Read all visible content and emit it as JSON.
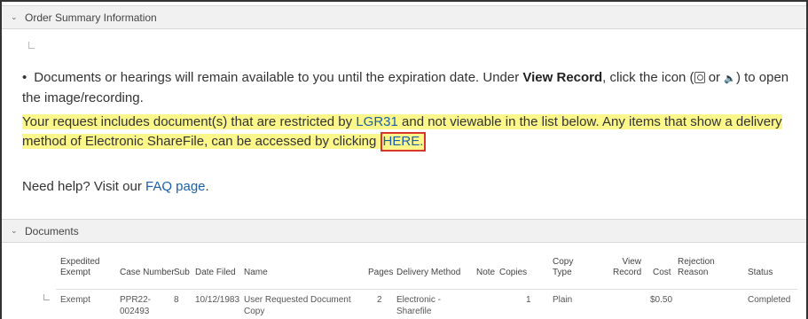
{
  "order_section": {
    "title": "Order Summary Information"
  },
  "notice": {
    "bullet": "•",
    "text_before": "Documents or hearings will remain available to you until the expiration date. Under ",
    "view_record": "View Record",
    "text_middle": ", click the icon (",
    "icon_or": " or ",
    "text_after": ") to open the image/recording."
  },
  "restricted": {
    "text_before": "Your request includes document(s) that are restricted by ",
    "lgr_link": "LGR31",
    "text_middle": " and not viewable in the list below. Any items that show a delivery method of Electronic ShareFile, can be accessed by clicking ",
    "here_link": "HERE."
  },
  "help": {
    "text": "Need help? Visit our ",
    "faq_link": "FAQ page",
    "end": "."
  },
  "documents_section": {
    "title": "Documents"
  },
  "table": {
    "headers": {
      "expedited": "Expedited",
      "exempt": "Exempt",
      "case_number": "Case Number",
      "sub": "Sub",
      "date_filed": "Date Filed",
      "name": "Name",
      "pages": "Pages",
      "delivery_method": "Delivery Method",
      "note": "Note",
      "copies": "Copies",
      "copy": "Copy",
      "type": "Type",
      "view": "View",
      "record": "Record",
      "cost": "Cost",
      "rejection": "Rejection",
      "reason": "Reason",
      "status": "Status"
    },
    "rows": [
      {
        "expedited": "Exempt",
        "case_number_1": "PPR22-",
        "case_number_2": "002493",
        "sub": "8",
        "date_filed": "10/12/1983",
        "name_1": "User Requested Document",
        "name_2": "Copy",
        "pages": "2",
        "delivery_1": "Electronic -",
        "delivery_2": "Sharefile",
        "copies": "1",
        "copy_type": "Plain",
        "cost": "$0.50",
        "status": "Completed"
      }
    ]
  }
}
